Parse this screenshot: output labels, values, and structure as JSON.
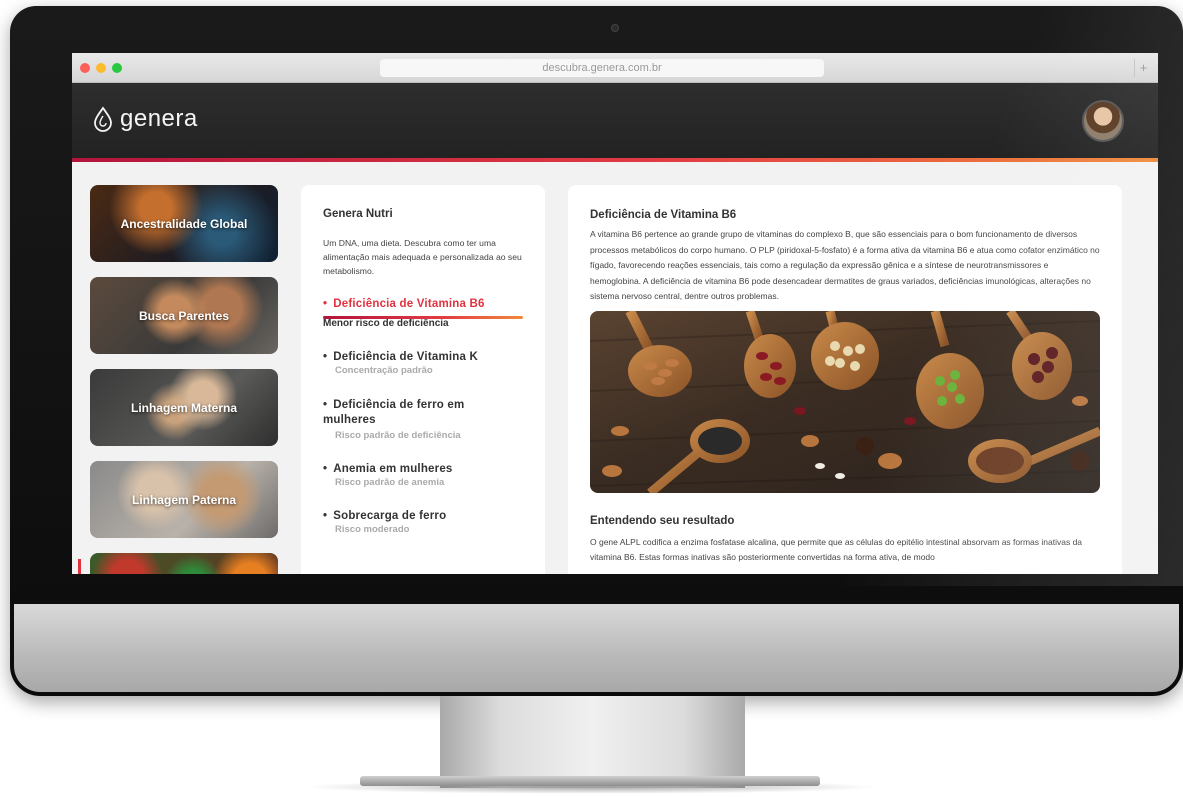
{
  "browser": {
    "url": "descubra.genera.com.br",
    "new_tab": "+"
  },
  "header": {
    "brand": "genera",
    "avatar": "user-avatar"
  },
  "colors": {
    "accent_red": "#e0323f",
    "accent_orange": "#f08a3a",
    "header_bg": "#262626"
  },
  "sidebar": {
    "items": [
      {
        "label": "Ancestralidade Global"
      },
      {
        "label": "Busca Parentes"
      },
      {
        "label": "Linhagem Materna"
      },
      {
        "label": "Linhagem Paterna"
      },
      {
        "label": ""
      }
    ]
  },
  "nutri": {
    "title": "Genera Nutri",
    "description": "Um DNA, uma dieta. Descubra como ter uma alimentação mais adequada e personalizada ao seu metabolismo.",
    "items": [
      {
        "label": "Deficiência de Vitamina B6",
        "sub": "Menor risco de deficiência",
        "active": true
      },
      {
        "label": "Deficiência de Vitamina K",
        "sub": "Concentração padrão"
      },
      {
        "label": "Deficiência de ferro em mulheres",
        "sub": "Risco padrão de deficiência"
      },
      {
        "label": "Anemia em mulheres",
        "sub": "Risco padrão de anemia"
      },
      {
        "label": "Sobrecarga de ferro",
        "sub": "Risco moderado"
      }
    ]
  },
  "detail": {
    "title": "Deficiência de Vitamina B6",
    "text": "A vitamina B6 pertence ao grande grupo de vitaminas do complexo B, que são essenciais para o bom funcionamento de diversos processos metabólicos do corpo humano. O PLP (piridoxal-5-fosfato) é a forma ativa da vitamina B6 e atua como cofator enzimático no fígado, favorecendo reações essenciais, tais como a regulação da expressão gênica e a síntese de neurotransmissores e hemoglobina. A deficiência de vitamina B6 pode desencadear dermatites de graus variados, deficiências imunológicas, alterações no sistema nervoso central, dentre outros problemas.",
    "result_title": "Entendendo seu resultado",
    "result_text": "O gene ALPL codifica a enzima fosfatase alcalina, que permite que as células do epitélio intestinal absorvam as formas inativas da vitamina B6. Estas formas inativas são posteriormente convertidas na forma ativa, de modo"
  }
}
